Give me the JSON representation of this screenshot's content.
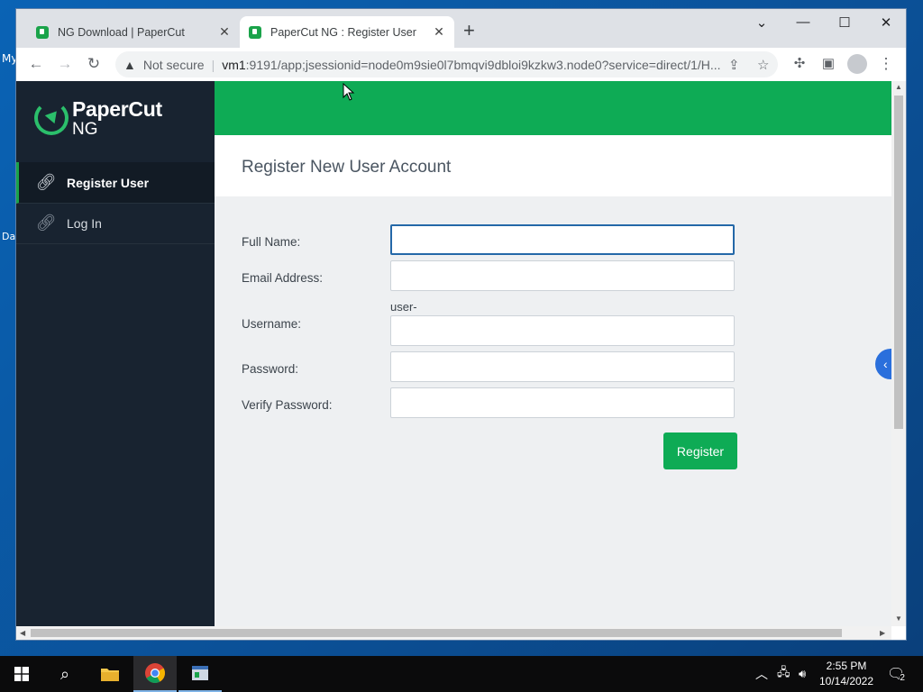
{
  "desktop": {
    "icon1_label": "My",
    "icon2_label": "Da"
  },
  "browser": {
    "tabs": [
      {
        "title": "NG Download | PaperCut",
        "active": false
      },
      {
        "title": "PaperCut NG : Register User",
        "active": true
      }
    ],
    "new_tab_symbol": "+",
    "window_controls": {
      "dropdown": "⌄",
      "minimize": "—",
      "maximize": "☐",
      "close": "✕"
    },
    "security_label": "Not secure",
    "url_host": "vm1",
    "url_rest": ":9191/app;jsessionid=node0m9sie0l7bmqvi9dbloi9kzkw3.node0?service=direct/1/H..."
  },
  "app": {
    "logo_word1": "PaperCut",
    "logo_word2": "NG",
    "nav": [
      {
        "label": "Register User",
        "icon": "link-icon",
        "active": true
      },
      {
        "label": "Log In",
        "icon": "link-icon",
        "active": false
      }
    ],
    "page_title": "Register New User Account",
    "form": {
      "full_name_label": "Full Name:",
      "email_label": "Email Address:",
      "username_prefix": "user-",
      "username_label": "Username:",
      "password_label": "Password:",
      "verify_password_label": "Verify Password:",
      "full_name_value": "",
      "email_value": "",
      "username_value": "",
      "password_value": "",
      "verify_password_value": ""
    },
    "register_button": "Register",
    "collapse_icon": "‹"
  },
  "taskbar": {
    "time": "2:55 PM",
    "date": "10/14/2022",
    "notification_count": "2"
  },
  "colors": {
    "brand_green": "#0eab55",
    "sidebar_bg": "#182330",
    "focus_blue": "#2468a8"
  }
}
